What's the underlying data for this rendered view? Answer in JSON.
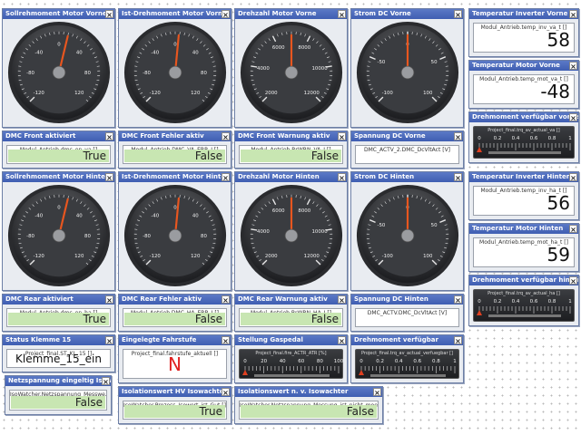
{
  "gauges": [
    {
      "title": "Sollrehmoment Motor Vorne",
      "ticks": [
        "-120",
        "-80",
        "-40",
        "0",
        "40",
        "80",
        "120"
      ],
      "needle": 0.55
    },
    {
      "title": "Ist-Drehmoment Motor Vorne",
      "ticks": [
        "-120",
        "-80",
        "-40",
        "0",
        "40",
        "80",
        "120"
      ],
      "needle": 0.52
    },
    {
      "title": "Drehzahl Motor Vorne",
      "ticks": [
        "2000",
        "4000",
        "6000",
        "8000",
        "10000",
        "12000"
      ],
      "needle": 0.5
    },
    {
      "title": "Strom DC Vorne",
      "ticks": [
        "-100",
        "-50",
        "0",
        "50",
        "100"
      ],
      "needle": 0.5
    },
    {
      "title": "Sollrehmoment Motor Hinten",
      "ticks": [
        "-120",
        "-80",
        "-40",
        "0",
        "40",
        "80",
        "120"
      ],
      "needle": 0.55
    },
    {
      "title": "Ist-Drehmoment Motor Hinten",
      "ticks": [
        "-120",
        "-80",
        "-40",
        "0",
        "40",
        "80",
        "120"
      ],
      "needle": 0.52
    },
    {
      "title": "Drehzahl Motor Hinten",
      "ticks": [
        "2000",
        "4000",
        "6000",
        "8000",
        "10000",
        "12000"
      ],
      "needle": 0.5
    },
    {
      "title": "Strom DC Hinten",
      "ticks": [
        "-100",
        "-50",
        "0",
        "50",
        "100"
      ],
      "needle": 0.5
    }
  ],
  "front_status": [
    {
      "title": "DMC Front aktiviert",
      "label": "Modul_Antrieb.dmc_en_va []",
      "value": "True"
    },
    {
      "title": "DMC Front Fehler aktiv",
      "label": "Modul_Antrieb.DMC_VA_ERR_I []",
      "value": "False"
    },
    {
      "title": "DMC Front Warnung aktiv",
      "label": "Modul_Antrieb.BrWRN_VA_I []",
      "value": "False"
    },
    {
      "title": "Spannung DC Vorne",
      "label": "DMC_ACTV_2.DMC_DcVltAct [V]",
      "value": ""
    }
  ],
  "rear_status": [
    {
      "title": "DMC Rear aktiviert",
      "label": "Modul_Antrieb.dmc_en_ha []",
      "value": "True"
    },
    {
      "title": "DMC Rear Fehler aktiv",
      "label": "Modul_Antrieb.DMC_HA_ERR_I []",
      "value": "False"
    },
    {
      "title": "DMC Rear Warnung aktiv",
      "label": "Modul_Antrieb.BrWRN_HA_I []",
      "value": "False"
    },
    {
      "title": "Spannung DC Hinten",
      "label": "DMC_ACTV.DMC_DcVltAct [V]",
      "value": ""
    }
  ],
  "right_front": {
    "temp_inverter": {
      "title": "Temperatur Inverter Vorne",
      "label": "Modul_Antrieb.temp_inv_va_t []",
      "value": "58"
    },
    "temp_motor": {
      "title": "Temperatur Motor Vorne",
      "label": "Modul_Antrieb.temp_mot_va_t []",
      "value": "-48"
    },
    "torque_avail": {
      "title": "Drehmoment verfügbar vorne",
      "label": "Project_final.trq_av_actual_va []",
      "ticks": [
        "0",
        "0.2",
        "0.4",
        "0.6",
        "0.8",
        "1"
      ]
    }
  },
  "right_rear": {
    "temp_inverter": {
      "title": "Temperatur Inverter Hinten",
      "label": "Modul_Antrieb.temp_inv_ha_t []",
      "value": "56"
    },
    "temp_motor": {
      "title": "Temperatur Motor Hinten",
      "label": "Modul_Antrieb.temp_mot_ha_t []",
      "value": "59"
    },
    "torque_avail": {
      "title": "Drehmoment verfügbar hinten",
      "label": "Project_final.trq_av_actual_ha []",
      "ticks": [
        "0",
        "0.2",
        "0.4",
        "0.6",
        "0.8",
        "1"
      ]
    }
  },
  "bottom": {
    "klemme": {
      "title": "Status Klemme 15",
      "label": "Project_final.ST_KL_15 []",
      "value": "Klemme_15_ein"
    },
    "fahrstufe": {
      "title": "Eingelegte Fahrstufe",
      "label": "Project_final.fahrstufe_aktuell []",
      "value": "N"
    },
    "gaspedal": {
      "title": "Stellung Gaspedal",
      "label": "Project_final.fire_ACTR_ATR [%]",
      "ticks": [
        "0",
        "20",
        "40",
        "60",
        "80",
        "100"
      ]
    },
    "drehmoment": {
      "title": "Drehmoment verfügbar",
      "label": "Project_final.trq_av_actual_verfuegbar []",
      "ticks": [
        "0",
        "0.2",
        "0.4",
        "0.6",
        "0.8",
        "1"
      ]
    },
    "netz": {
      "title": "Netzspannung eingeltig Isowac...",
      "label": "IsoWatcher.Netzspannung_Messwe...",
      "value": "False"
    },
    "iso_hv": {
      "title": "Isolationswert HV Isowachter",
      "label": "IsoWatcher.Prozess_Isowert_ist_Gut []",
      "value": "True"
    },
    "iso_nv": {
      "title": "Isolationswert n. v. Isowachter",
      "label": "IsoWatcher.Netzspannung_Messung_ist_nicht_moegl []",
      "value": "False"
    }
  },
  "colors": {
    "titlebar": "#4a69bb",
    "boolean_bg": "#c8e6b2",
    "needle": "#e8561f",
    "red_text": "#e02020"
  }
}
